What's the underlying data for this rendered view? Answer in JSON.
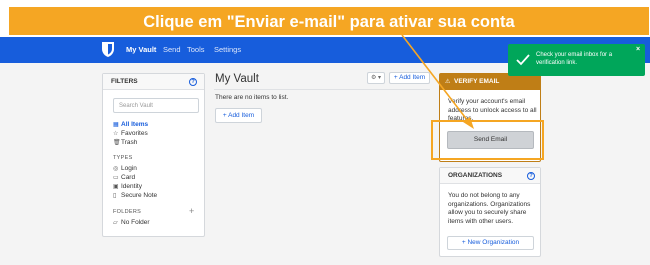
{
  "annotation": {
    "banner_text": "Clique em \"Enviar e-mail\" para ativar sua conta",
    "color": "#f5a623"
  },
  "navbar": {
    "logo": "bitwarden-shield-icon",
    "items": [
      {
        "label": "My Vault",
        "active": true
      },
      {
        "label": "Send",
        "active": false
      },
      {
        "label": "Tools",
        "active": false
      },
      {
        "label": "Settings",
        "active": false
      }
    ],
    "color": "#175ddc"
  },
  "filters": {
    "title": "FILTERS",
    "search_placeholder": "Search Vault",
    "items": [
      {
        "label": "All Items",
        "icon": "grid-icon",
        "selected": true
      },
      {
        "label": "Favorites",
        "icon": "star-icon",
        "selected": false
      },
      {
        "label": "Trash",
        "icon": "trash-icon",
        "selected": false
      }
    ],
    "types_heading": "TYPES",
    "types": [
      {
        "label": "Login",
        "icon": "globe-icon"
      },
      {
        "label": "Card",
        "icon": "card-icon"
      },
      {
        "label": "Identity",
        "icon": "id-icon"
      },
      {
        "label": "Secure Note",
        "icon": "note-icon"
      }
    ],
    "folders_heading": "FOLDERS",
    "folders": [
      {
        "label": "No Folder",
        "icon": "folder-icon"
      }
    ]
  },
  "vault": {
    "title": "My Vault",
    "empty_text": "There are no items to list.",
    "add_item_label": "Add Item",
    "header_add_label": "Add Item"
  },
  "verify_email": {
    "title": "VERIFY EMAIL",
    "text": "Verify your account's email address to unlock access to all features.",
    "button_label": "Send Email",
    "color": "#bf7e16"
  },
  "organizations": {
    "title": "ORGANIZATIONS",
    "text": "You do not belong to any organizations. Organizations allow you to securely share items with other users.",
    "button_label": "New Organization"
  },
  "toast": {
    "text": "Check your email inbox for a verification link.",
    "color": "#00a65a"
  }
}
